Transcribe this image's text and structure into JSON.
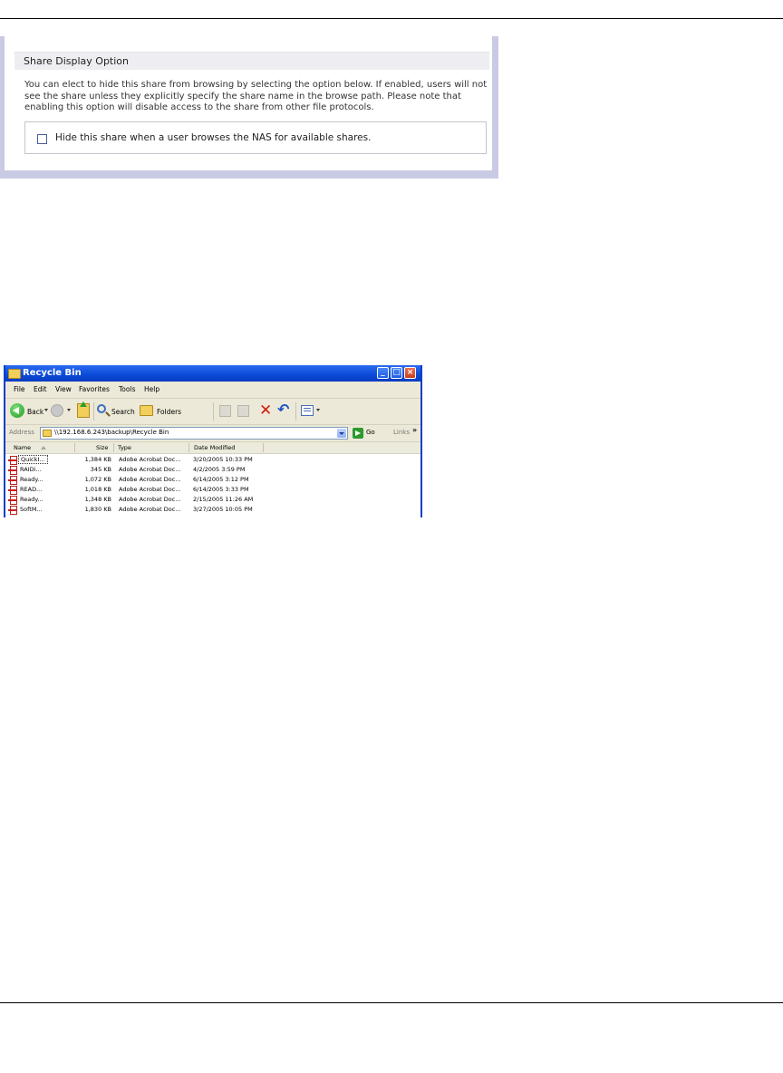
{
  "share_panel": {
    "header": "Share Display Option",
    "description": "You can elect to hide this share from browsing by selecting the option below. If enabled, users will not see the share unless they explicitly specify the share name in the browse path. Please note that enabling this option will disable access to the share from other file protocols.",
    "checkbox_label": "Hide this share when a user browses the NAS for available shares.",
    "checkbox_checked": false
  },
  "explorer": {
    "title": "Recycle Bin",
    "menu": [
      "File",
      "Edit",
      "View",
      "Favorites",
      "Tools",
      "Help"
    ],
    "toolbar": {
      "back": "Back",
      "search": "Search",
      "folders": "Folders"
    },
    "address": {
      "label": "Address",
      "value": "\\\\192.168.6.243\\backup\\Recycle Bin",
      "go": "Go",
      "links": "Links",
      "links_more": "»"
    },
    "columns": [
      "Name",
      "Size",
      "Type",
      "Date Modified"
    ],
    "files": [
      {
        "name": "QuickI...",
        "size": "1,384 KB",
        "type": "Adobe Acrobat Doc...",
        "date": "3/20/2005 10:33 PM"
      },
      {
        "name": "RAIDi...",
        "size": "345 KB",
        "type": "Adobe Acrobat Doc...",
        "date": "4/2/2005 3:59 PM"
      },
      {
        "name": "Ready...",
        "size": "1,072 KB",
        "type": "Adobe Acrobat Doc...",
        "date": "6/14/2005 3:12 PM"
      },
      {
        "name": "READ...",
        "size": "1,018 KB",
        "type": "Adobe Acrobat Doc...",
        "date": "6/14/2005 3:33 PM"
      },
      {
        "name": "Ready...",
        "size": "1,348 KB",
        "type": "Adobe Acrobat Doc...",
        "date": "2/15/2005 11:26 AM"
      },
      {
        "name": "SoftM...",
        "size": "1,830 KB",
        "type": "Adobe Acrobat Doc...",
        "date": "3/27/2005 10:05 PM"
      }
    ]
  }
}
